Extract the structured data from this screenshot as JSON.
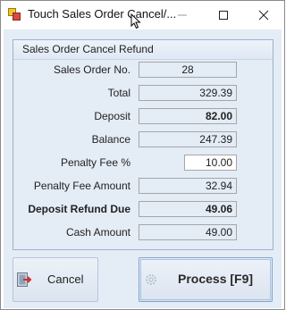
{
  "window": {
    "title": "Touch Sales Order Cancel/..."
  },
  "group": {
    "title": "Sales Order Cancel Refund"
  },
  "rows": [
    {
      "label": "Sales Order No.",
      "value": "28"
    },
    {
      "label": "Total",
      "value": "329.39"
    },
    {
      "label": "Deposit",
      "value": "82.00"
    },
    {
      "label": "Balance",
      "value": "247.39"
    },
    {
      "label": "Penalty Fee %",
      "value": "10.00"
    },
    {
      "label": "Penalty Fee Amount",
      "value": "32.94"
    },
    {
      "label": "Deposit Refund Due",
      "value": "49.06"
    },
    {
      "label": "Cash Amount",
      "value": "49.00"
    }
  ],
  "buttons": {
    "cancel_label": "Cancel",
    "process_label": "Process [F9]"
  }
}
